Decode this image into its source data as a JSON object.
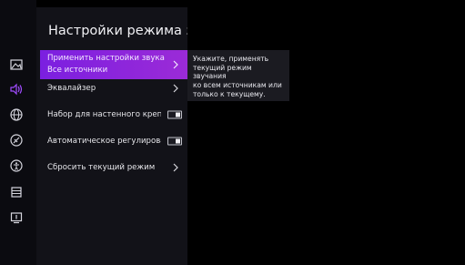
{
  "panel": {
    "title": "Настройки режима звук",
    "items": [
      {
        "label_line1": "Применить настройки звука",
        "label_line2": "Все источники"
      },
      {
        "label": "Эквалайзер"
      },
      {
        "label": "Набор для настенного креп..."
      },
      {
        "label": "Автоматическое регулирова..."
      },
      {
        "label": "Сбросить текущий режим"
      }
    ]
  },
  "tooltip": {
    "line1": "Укажите, применять",
    "line2": "текущий режим звучания",
    "line3": "ко всем источникам или",
    "line4": "только к текущему."
  },
  "sidebar": {
    "icons": [
      "picture-icon",
      "sound-icon",
      "network-icon",
      "general-icon",
      "accessibility-icon",
      "support-icon",
      "device-icon"
    ]
  },
  "colors": {
    "accent_start": "#7b1fe0",
    "accent_end": "#9b2bd7"
  }
}
